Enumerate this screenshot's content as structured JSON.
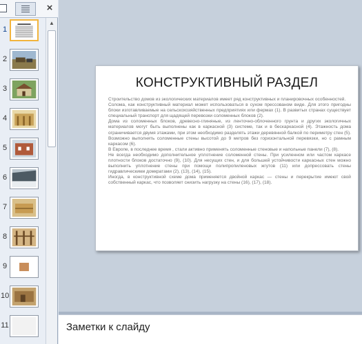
{
  "thumbnails_pane": {
    "close_glyph": "×",
    "slides": [
      {
        "number": "1",
        "selected": true,
        "kind": "text-slide"
      },
      {
        "number": "2",
        "selected": false,
        "kind": "photo-field"
      },
      {
        "number": "3",
        "selected": false,
        "kind": "photo-house"
      },
      {
        "number": "4",
        "selected": false,
        "kind": "photo-frame"
      },
      {
        "number": "5",
        "selected": false,
        "kind": "photo-brick"
      },
      {
        "number": "6",
        "selected": false,
        "kind": "photo-hangar"
      },
      {
        "number": "7",
        "selected": false,
        "kind": "photo-bales"
      },
      {
        "number": "8",
        "selected": false,
        "kind": "photo-wall"
      },
      {
        "number": "9",
        "selected": false,
        "kind": "photo-small"
      },
      {
        "number": "10",
        "selected": false,
        "kind": "photo-hut"
      },
      {
        "number": "11",
        "selected": false,
        "kind": "partial"
      }
    ]
  },
  "slide": {
    "title": "КОНСТРУКТИВНЫЙ РАЗДЕЛ",
    "paragraphs": [
      "Строительство домов из экологических материалов имеет ряд конструктивных и планировочных особенностей.",
      "Солома, как конструктивный материал может использоваться в сухом прессованом виде. Для этого пригодны блоки изготавливаемые на сельскохозяйственных предприятиях или фермах (1). В развитых странах существует специальный транспорт для щадящей перевозки соломенных блоков (2).",
      "Дома из соломенных блоков, древесно-глиняные, из ленточно-облоченного грунта и других экологичных материалов могут быть выполнены как в каркасной (3) системе, так и в бескаркасной (4). Этажность дома ограничивается двумя этажами, при этом необходимо разделять этажи деревянной балкой по периметру стен (5). Возможно выполнять соломенные стены высотой до 9 метров без горизонтальной перевязки, но с рамным каркасом (6).",
      "В Европе, в последнее время , стали активно применять  соломенные стеновые и напольные панели (7), (8).",
      "Не всегда необходимо дополнительное уплотнение соломенной стены. При усиленном или частом каркасе плотности блоков достаточно (9), (10). Для несущих стен, и для большей устойчивости каркасных стен можно выполнить уплотнение стены при помощи полипропиленовых жгутов (11) или допрессовать стены гидравлическими домкратами (2), (13), (14), (15).",
      "Иногда, в конструктивной схеме дома применяется двойной каркас — стены и перекрытие имеют свой собственный каркас, что позволяет снизить нагрузку на стены (16), (17), (18)."
    ]
  },
  "notes": {
    "placeholder": "Заметки к слайду"
  },
  "colors": {
    "selection": "#f2b43c",
    "workspace": "#c6d0dc",
    "pane": "#e9eef5"
  }
}
